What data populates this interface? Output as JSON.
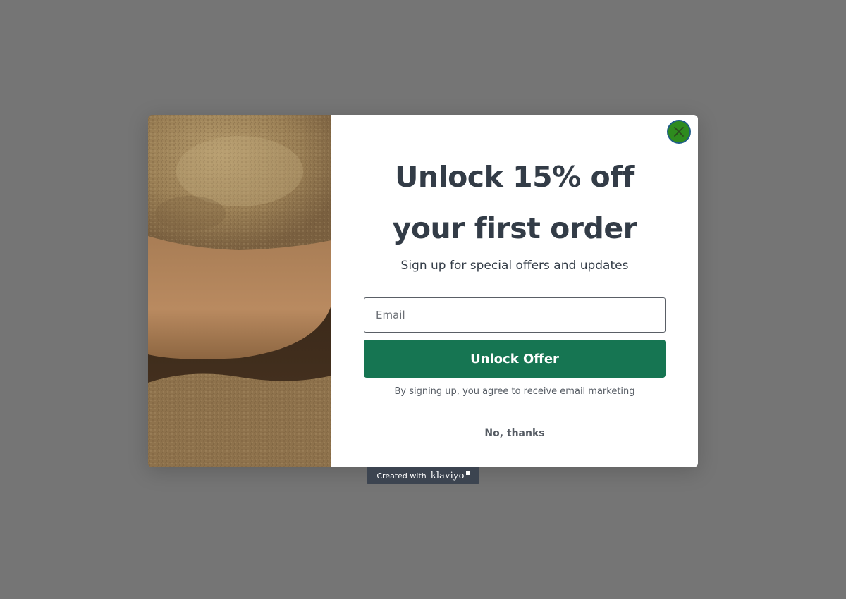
{
  "popup": {
    "close_icon": "close-icon",
    "image_description": "powder-spoon-photo",
    "headline_line1": "Unlock 15% off",
    "headline_line2": "your first order",
    "subheadline": "Sign up for special offers and updates",
    "email": {
      "placeholder": "Email",
      "value": ""
    },
    "submit_label": "Unlock Offer",
    "disclaimer": "By signing up, you agree to receive email marketing",
    "decline_label": "No, thanks"
  },
  "credit": {
    "prefix": "Created with",
    "brand": "klaviyo"
  },
  "colors": {
    "backdrop": "#757575",
    "accent": "#167552",
    "text": "#333c47",
    "close_button": "#2e8b1e"
  }
}
